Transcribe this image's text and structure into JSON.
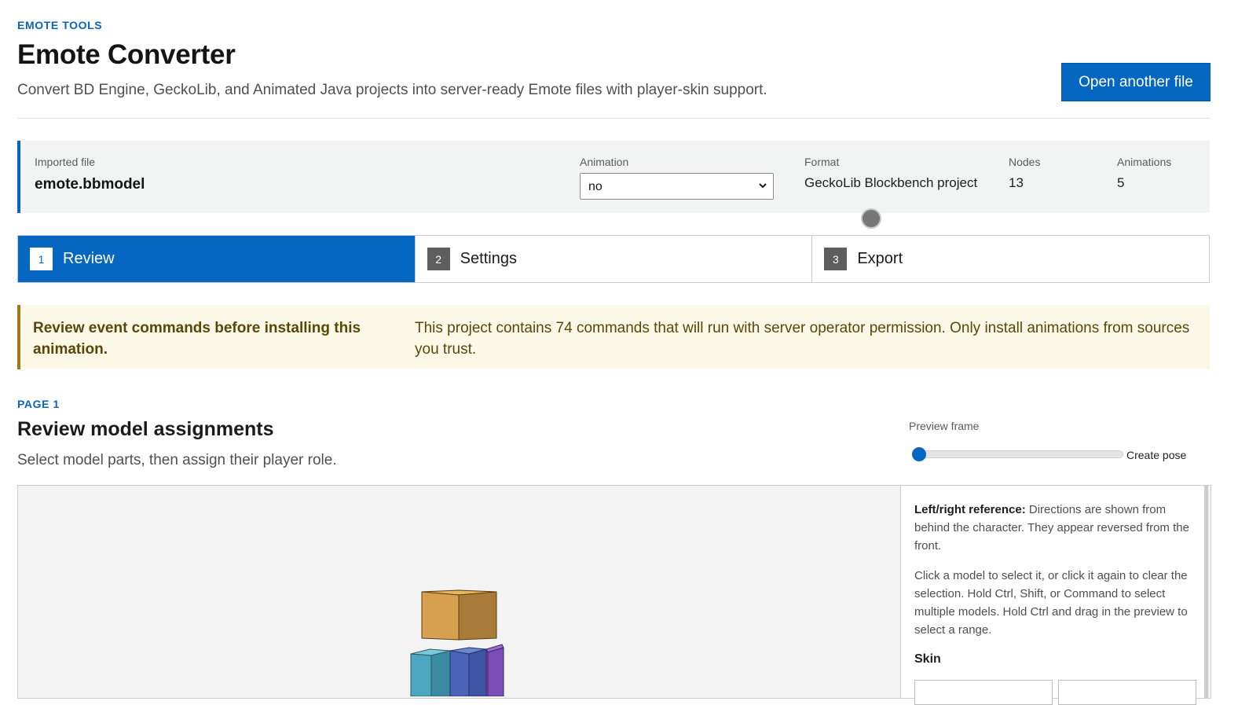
{
  "header": {
    "eyebrow": "EMOTE TOOLS",
    "title": "Emote Converter",
    "subtitle": "Convert BD Engine, GeckoLib, and Animated Java projects into server-ready Emote files with player-skin support.",
    "open_button": "Open another file"
  },
  "file_info": {
    "imported_label": "Imported file",
    "imported_value": "emote.bbmodel",
    "animation_label": "Animation",
    "animation_selected": "no",
    "format_label": "Format",
    "format_value": "GeckoLib Blockbench project",
    "nodes_label": "Nodes",
    "nodes_value": "13",
    "animations_label": "Animations",
    "animations_value": "5"
  },
  "steps": [
    {
      "num": "1",
      "label": "Review",
      "active": true
    },
    {
      "num": "2",
      "label": "Settings",
      "active": false
    },
    {
      "num": "3",
      "label": "Export",
      "active": false
    }
  ],
  "warning": {
    "title": "Review event commands before installing this animation.",
    "body": "This project contains 74 commands that will run with server operator permission. Only install animations from sources you trust."
  },
  "page": {
    "eyebrow": "PAGE 1",
    "title": "Review model assignments",
    "subtitle": "Select model parts, then assign their player role."
  },
  "preview_control": {
    "label": "Preview frame",
    "slider_value": 0,
    "pose_label": "Create pose"
  },
  "side_panel": {
    "ref_title": "Left/right reference:",
    "ref_text": "Directions are shown from behind the character. They appear reversed from the front.",
    "instructions": "Click a model to select it, or click it again to clear the selection. Hold Ctrl, Shift, or Command to select multiple models. Hold Ctrl and drag in the preview to select a range.",
    "skin_label": "Skin"
  },
  "colors": {
    "accent": "#0567c2",
    "warning_bg": "#fbf8e8",
    "warning_border": "#9a7a1a",
    "head_block": "#d6a050",
    "body_left": "#4ba6c0",
    "body_mid": "#4b63b8",
    "body_right": "#7a4db8"
  }
}
